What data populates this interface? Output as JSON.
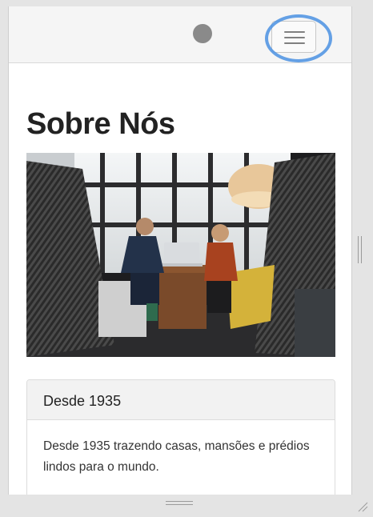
{
  "header": {
    "menu_toggle_label": "Toggle navigation",
    "menu_icon": "hamburger-icon"
  },
  "page": {
    "title": "Sobre Nós"
  },
  "hero_image": {
    "alt": "Duas pessoas conversando com um laptop em uma cabine de escritório"
  },
  "panel": {
    "heading": "Desde 1935",
    "body": "Desde 1935 trazendo casas, mansões e prédios lindos para o mundo."
  },
  "colors": {
    "highlight_ring": "#4a90e2",
    "navbar_bg": "#f5f5f5",
    "panel_head_bg": "#f2f2f2",
    "text": "#222222"
  }
}
